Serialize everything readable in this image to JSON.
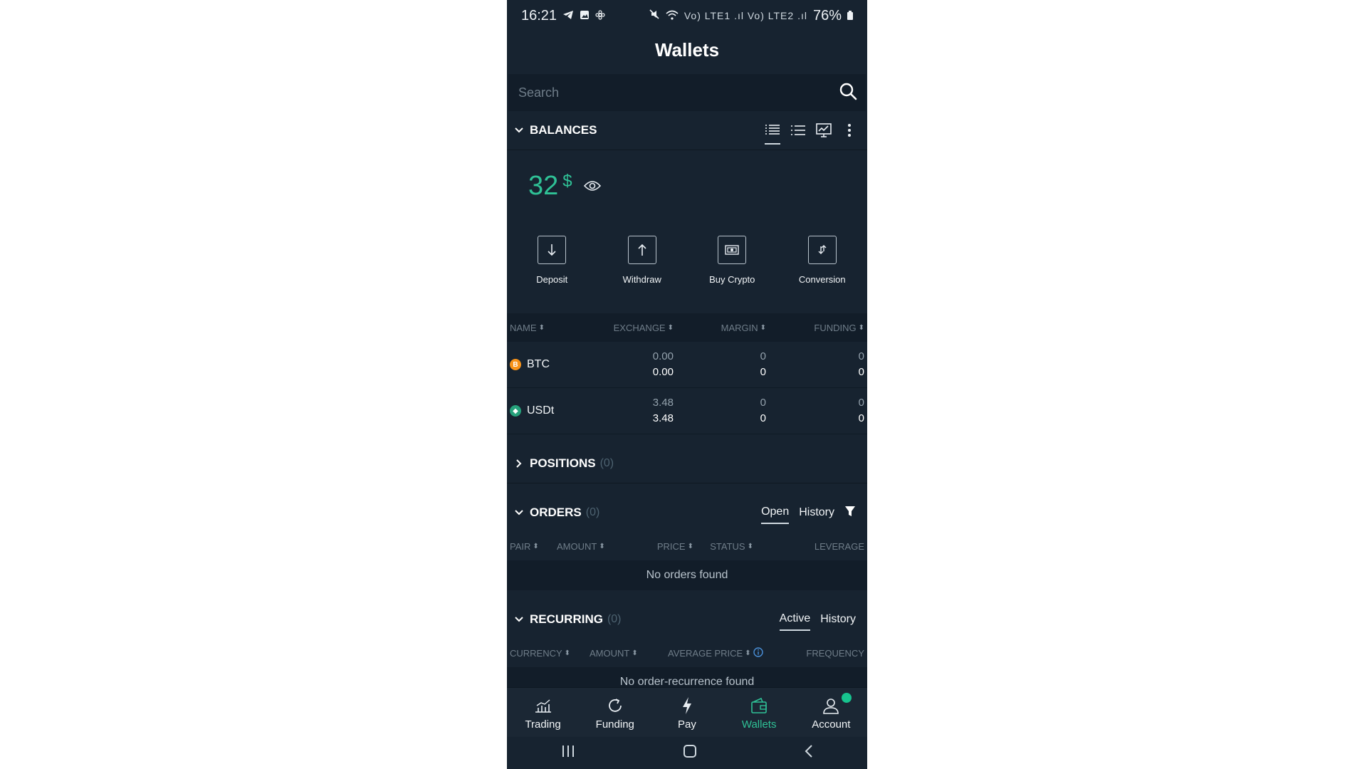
{
  "status_bar": {
    "time": "16:21",
    "battery": "76%",
    "signal_text": "Vo) LTE1 .ıl Vo) LTE2 .ıl"
  },
  "header": {
    "title": "Wallets"
  },
  "search": {
    "placeholder": "Search"
  },
  "balances": {
    "title": "BALANCES",
    "total_value": "32",
    "currency_symbol": "$",
    "actions": [
      {
        "label": "Deposit",
        "icon": "arrow-down-icon"
      },
      {
        "label": "Withdraw",
        "icon": "arrow-up-icon"
      },
      {
        "label": "Buy Crypto",
        "icon": "banknote-icon"
      },
      {
        "label": "Conversion",
        "icon": "swap-icon"
      }
    ],
    "columns": [
      "NAME",
      "EXCHANGE",
      "MARGIN",
      "FUNDING"
    ],
    "rows": [
      {
        "name": "BTC",
        "icon_color": "#f7931a",
        "icon_glyph": "B",
        "exchange": [
          "0.00",
          "0.00"
        ],
        "margin": [
          "0",
          "0"
        ],
        "funding": [
          "0",
          "0"
        ]
      },
      {
        "name": "USDt",
        "icon_color": "#26a17b",
        "icon_glyph": "◆",
        "exchange": [
          "3.48",
          "3.48"
        ],
        "margin": [
          "0",
          "0"
        ],
        "funding": [
          "0",
          "0"
        ]
      }
    ]
  },
  "positions": {
    "title": "POSITIONS",
    "count": "(0)"
  },
  "orders": {
    "title": "ORDERS",
    "count": "(0)",
    "tabs": [
      "Open",
      "History"
    ],
    "columns": [
      "PAIR",
      "AMOUNT",
      "PRICE",
      "STATUS",
      "LEVERAGE"
    ],
    "empty_text": "No orders found"
  },
  "recurring": {
    "title": "RECURRING",
    "count": "(0)",
    "tabs": [
      "Active",
      "History"
    ],
    "columns": [
      "CURRENCY",
      "AMOUNT",
      "AVERAGE PRICE",
      "FREQUENCY"
    ],
    "empty_text": "No order-recurrence found"
  },
  "bottom_nav": [
    {
      "label": "Trading",
      "icon": "chart-icon"
    },
    {
      "label": "Funding",
      "icon": "refresh-icon"
    },
    {
      "label": "Pay",
      "icon": "lightning-icon"
    },
    {
      "label": "Wallets",
      "icon": "wallet-icon"
    },
    {
      "label": "Account",
      "icon": "user-icon"
    }
  ],
  "colors": {
    "accent": "#2fc196",
    "background": "#172330",
    "badge": "#17c38e"
  }
}
